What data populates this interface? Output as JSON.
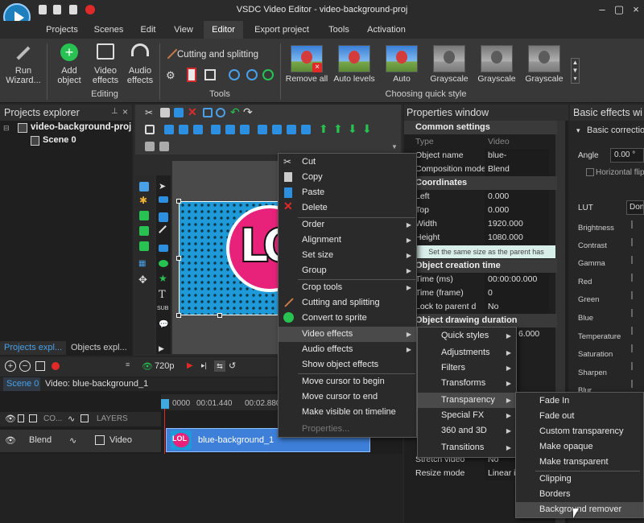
{
  "window": {
    "title": "VSDC Video Editor - video-background-proj"
  },
  "menu": [
    {
      "label": "Projects"
    },
    {
      "label": "Scenes"
    },
    {
      "label": "Edit"
    },
    {
      "label": "View"
    },
    {
      "label": "Editor",
      "active": true
    },
    {
      "label": "Export project"
    },
    {
      "label": "Tools"
    },
    {
      "label": "Activation"
    }
  ],
  "ribbon": {
    "run_wizard": "Run\nWizard...",
    "add_object": "Add\nobject",
    "video_effects": "Video\neffects",
    "audio_effects": "Audio\neffects",
    "group_editing": "Editing",
    "cutting_splitting": "Cutting and splitting",
    "group_tools": "Tools",
    "quick_style": [
      {
        "label": "Remove all"
      },
      {
        "label": "Auto levels"
      },
      {
        "label": "Auto"
      },
      {
        "label": "Grayscale"
      },
      {
        "label": "Grayscale"
      },
      {
        "label": "Grayscale"
      }
    ],
    "group_quick_style": "Choosing quick style"
  },
  "projects_explorer": {
    "title": "Projects explorer",
    "project_name": "video-background-proj",
    "scene": "Scene 0",
    "tab1": "Projects expl...",
    "tab2": "Objects expl..."
  },
  "preview": {
    "logo_text": "LOL"
  },
  "timeline": {
    "resolution": "720p",
    "tab_scene": "Scene 0",
    "tab_video": "Video: blue-background_1",
    "ruler": [
      "0000",
      "00:01.440",
      "00:02.880"
    ],
    "layer_header_co": "CO...",
    "layer_header_layers": "LAYERS",
    "blend": "Blend",
    "video_label": "Video",
    "clip_name": "blue-background_1"
  },
  "properties": {
    "title": "Properties window",
    "sec_common": "Common settings",
    "type_k": "Type",
    "type_v": "Video",
    "objname_k": "Object name",
    "objname_v": "blue-background",
    "compmode_k": "Composition mode",
    "compmode_v": "Blend",
    "sec_coords": "Coordinates",
    "left_k": "Left",
    "left_v": "0.000",
    "top_k": "Top",
    "top_v": "0.000",
    "width_k": "Width",
    "width_v": "1920.000",
    "height_k": "Height",
    "height_v": "1080.000",
    "same_size": "Set the same size as the parent has",
    "sec_creation": "Object creation time",
    "timems_k": "Time (ms)",
    "timems_v": "00:00:00.000",
    "timeframe_k": "Time (frame)",
    "timeframe_v": "0",
    "lock_k": "Lock to parent d",
    "lock_v": "No",
    "sec_drawing": "Object drawing duration",
    "dur_partial": "6.000",
    "stretch_k": "Stretch video",
    "stretch_v": "No",
    "resize_k": "Resize mode",
    "resize_v": "Linear i"
  },
  "basic_effects": {
    "title": "Basic effects wi",
    "basic_correction": "Basic correctio",
    "angle_k": "Angle",
    "angle_v": "0.00 °",
    "horizontal_flip": "Horizontal flip",
    "lut_k": "LUT",
    "lut_v": "Don'",
    "sliders": [
      "Brightness",
      "Contrast",
      "Gamma",
      "Red",
      "Green",
      "Blue",
      "Temperature",
      "Saturation",
      "Sharpen",
      "Blur"
    ]
  },
  "context_menu": [
    {
      "label": "Cut"
    },
    {
      "label": "Copy"
    },
    {
      "label": "Paste"
    },
    {
      "label": "Delete"
    },
    {
      "label": "Order"
    },
    {
      "label": "Alignment"
    },
    {
      "label": "Set size"
    },
    {
      "label": "Group"
    },
    {
      "label": "Crop tools"
    },
    {
      "label": "Cutting and splitting"
    },
    {
      "label": "Convert to sprite"
    },
    {
      "label": "Video effects"
    },
    {
      "label": "Audio effects"
    },
    {
      "label": "Show object effects"
    },
    {
      "label": "Move cursor to begin"
    },
    {
      "label": "Move cursor to end"
    },
    {
      "label": "Make visible on timeline"
    },
    {
      "label": "Properties..."
    }
  ],
  "video_effects_submenu": [
    {
      "label": "Quick styles"
    },
    {
      "label": "Adjustments"
    },
    {
      "label": "Filters"
    },
    {
      "label": "Transforms"
    },
    {
      "label": "Transparency"
    },
    {
      "label": "Special FX"
    },
    {
      "label": "360 and 3D"
    },
    {
      "label": "Transitions"
    }
  ],
  "transparency_submenu": [
    {
      "label": "Fade In"
    },
    {
      "label": "Fade out"
    },
    {
      "label": "Custom transparency"
    },
    {
      "label": "Make opaque"
    },
    {
      "label": "Make transparent"
    },
    {
      "label": "Clipping"
    },
    {
      "label": "Borders"
    },
    {
      "label": "Background remover"
    }
  ],
  "colors": {
    "accent": "#4aa0e6",
    "bg_dark": "#1f1f1f",
    "menu_bg": "#2a2a2a",
    "highlight": "#4a4a4a",
    "clip": "#3d7fd9",
    "green": "#27c251",
    "red": "#e02a2a"
  }
}
